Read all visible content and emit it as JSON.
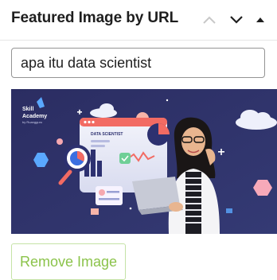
{
  "panel": {
    "title": "Featured Image by URL",
    "controls": [
      {
        "name": "move-up",
        "icon": "chevron-up-icon"
      },
      {
        "name": "move-down",
        "icon": "chevron-down-icon"
      },
      {
        "name": "toggle-panel",
        "icon": "caret-up-icon"
      }
    ]
  },
  "image_url_field": {
    "value": "apa itu data scientist"
  },
  "preview_image": {
    "brand_lines": [
      "Skill",
      "Academy",
      "by Ruangguru"
    ],
    "screen_label": "DATA SCIENTIST"
  },
  "actions": {
    "remove_label": "Remove Image"
  },
  "colors": {
    "accent": "#8bc34a",
    "text": "#1e1e1e",
    "preview_background": "#2c2e63"
  }
}
